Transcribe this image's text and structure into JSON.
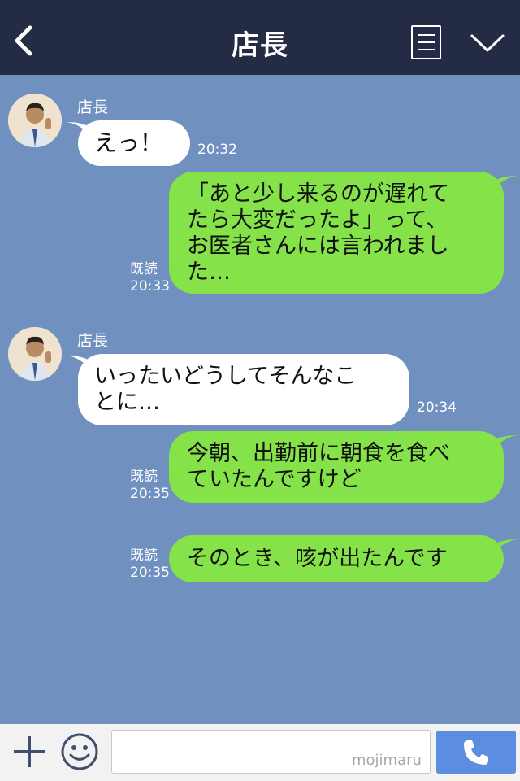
{
  "header": {
    "title": "店長",
    "back_icon": "chevron-left-icon",
    "menu_icon": "note-list-icon",
    "collapse_icon": "chevron-down-icon"
  },
  "colors": {
    "header_bg": "#232b45",
    "chat_bg": "#7090c0",
    "incoming_bubble": "#ffffff",
    "outgoing_bubble": "#85e249",
    "call_button": "#5b8de0"
  },
  "messages": [
    {
      "side": "in",
      "sender": "店長",
      "text": "えっ！",
      "time": "20:32"
    },
    {
      "side": "out",
      "text": "「あと少し来るのが遅れてたら大変だったよ」って、お医者さんには言われました…",
      "lines": [
        "「あと少し来るのが遅れて",
        "たら大変だったよ」って、",
        "お医者さんには言われまし",
        "た…"
      ],
      "read": "既読",
      "time": "20:33"
    },
    {
      "side": "in",
      "sender": "店長",
      "text": "いったいどうしてそんなことに…",
      "lines": [
        "いったいどうしてそんなこ",
        "とに…"
      ],
      "time": "20:34"
    },
    {
      "side": "out",
      "text": "今朝、出勤前に朝食を食べていたんですけど",
      "lines": [
        "今朝、出勤前に朝食を食べ",
        "ていたんですけど"
      ],
      "read": "既読",
      "time": "20:35"
    },
    {
      "side": "out",
      "text": "そのとき、咳が出たんです",
      "read": "既読",
      "time": "20:35"
    }
  ],
  "footer": {
    "input_value": "",
    "watermark": "mojimaru",
    "plus_icon": "plus-icon",
    "emoji_icon": "smiley-icon",
    "call_icon": "phone-icon"
  }
}
